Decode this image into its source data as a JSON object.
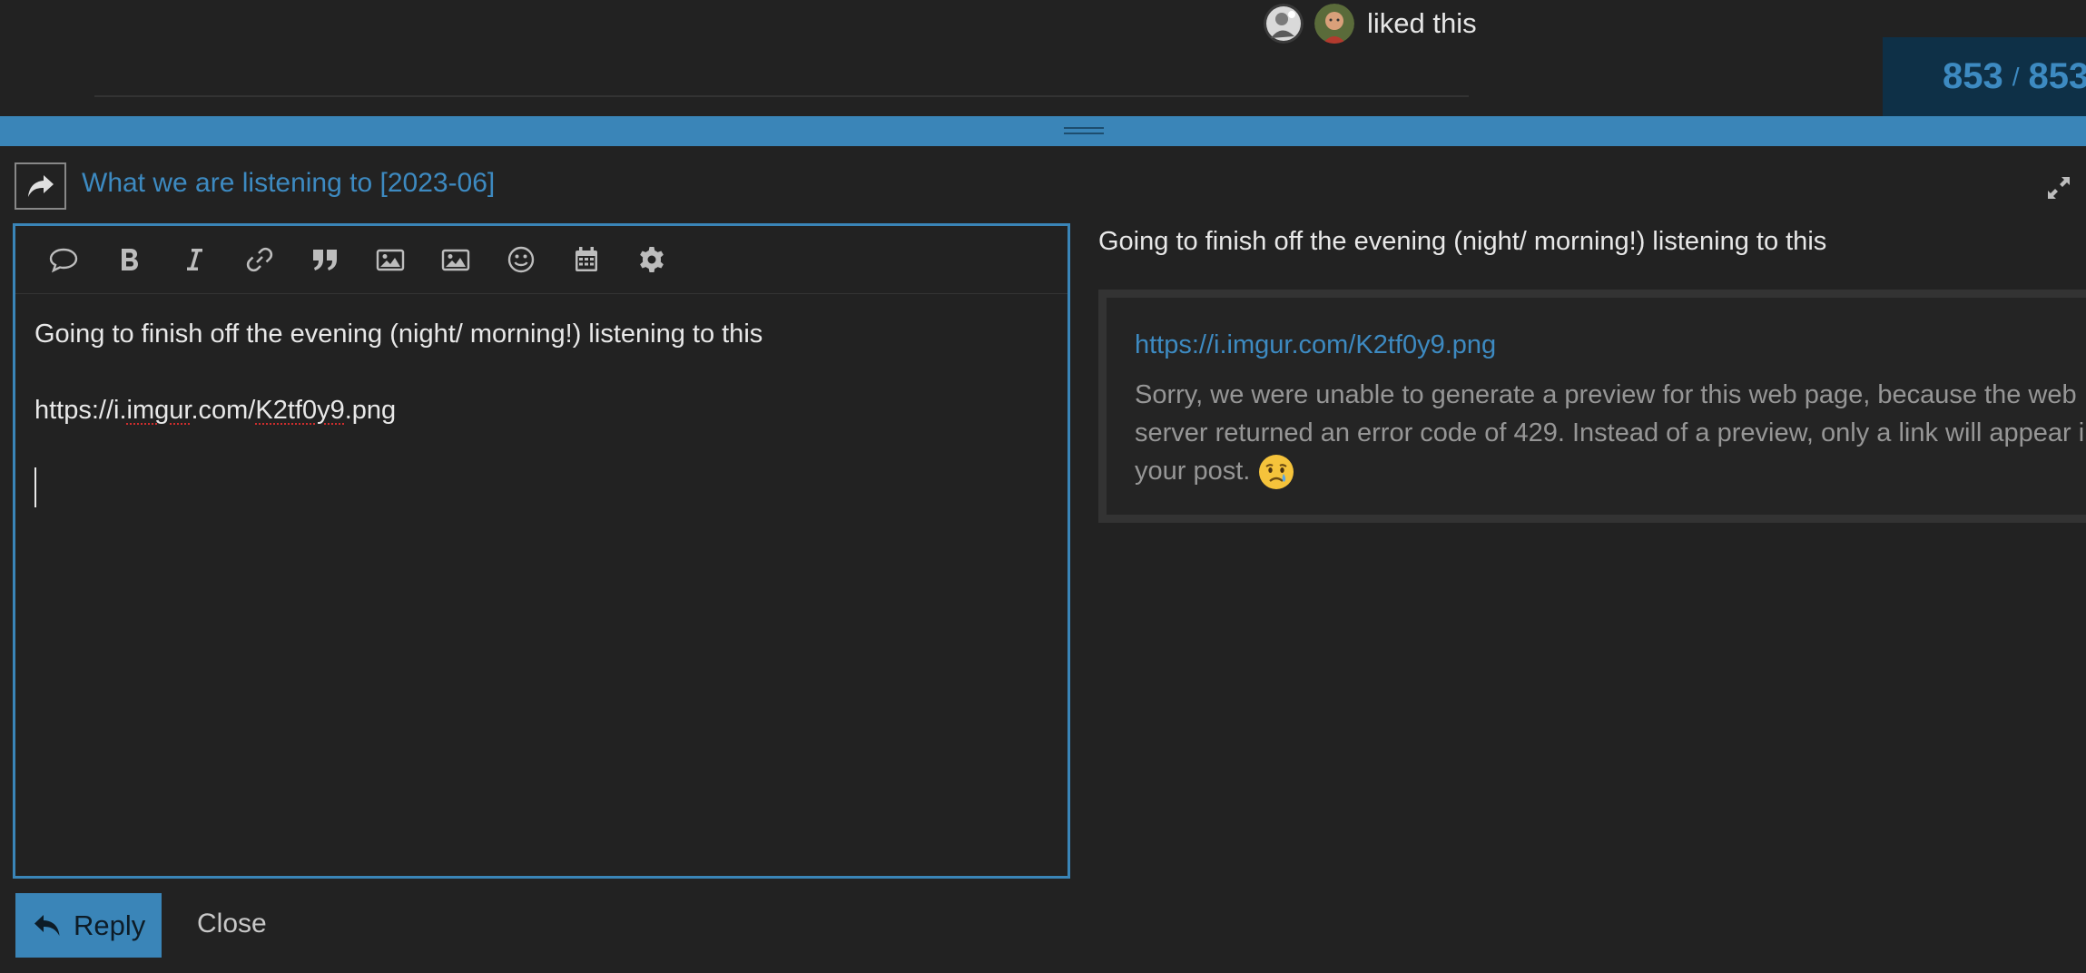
{
  "likes": {
    "text": "liked this"
  },
  "progress": {
    "current": "853",
    "separator": "/",
    "total": "853"
  },
  "composer": {
    "topic_title": "What we are listening to [2023-06]",
    "toolbar": [
      {
        "name": "speech-bubble-icon"
      },
      {
        "name": "bold-icon"
      },
      {
        "name": "italic-icon"
      },
      {
        "name": "link-icon"
      },
      {
        "name": "quote-icon"
      },
      {
        "name": "image-icon"
      },
      {
        "name": "image-upload-icon"
      },
      {
        "name": "emoji-icon"
      },
      {
        "name": "calendar-icon"
      },
      {
        "name": "gear-icon"
      }
    ],
    "editor_lines": {
      "line1": "Going to finish off the evening (night/ morning!) listening to this",
      "link_prefix": "https://i.",
      "link_word1": "imgur",
      "link_mid": ".com/",
      "link_word2": "K2tf0y9",
      "link_suffix": ".png"
    }
  },
  "preview": {
    "line1": "Going to finish off the evening (night/ morning!) listening to this",
    "onebox_link": "https://i.imgur.com/K2tf0y9.png",
    "onebox_message": "Sorry, we were unable to generate a preview for this web page, because the web server returned an error code of 429. Instead of a preview, only a link will appear in your post."
  },
  "buttons": {
    "reply": "Reply",
    "close": "Close"
  },
  "colors": {
    "accent": "#3a85b8",
    "link": "#3d8ac1",
    "background": "#222222"
  }
}
